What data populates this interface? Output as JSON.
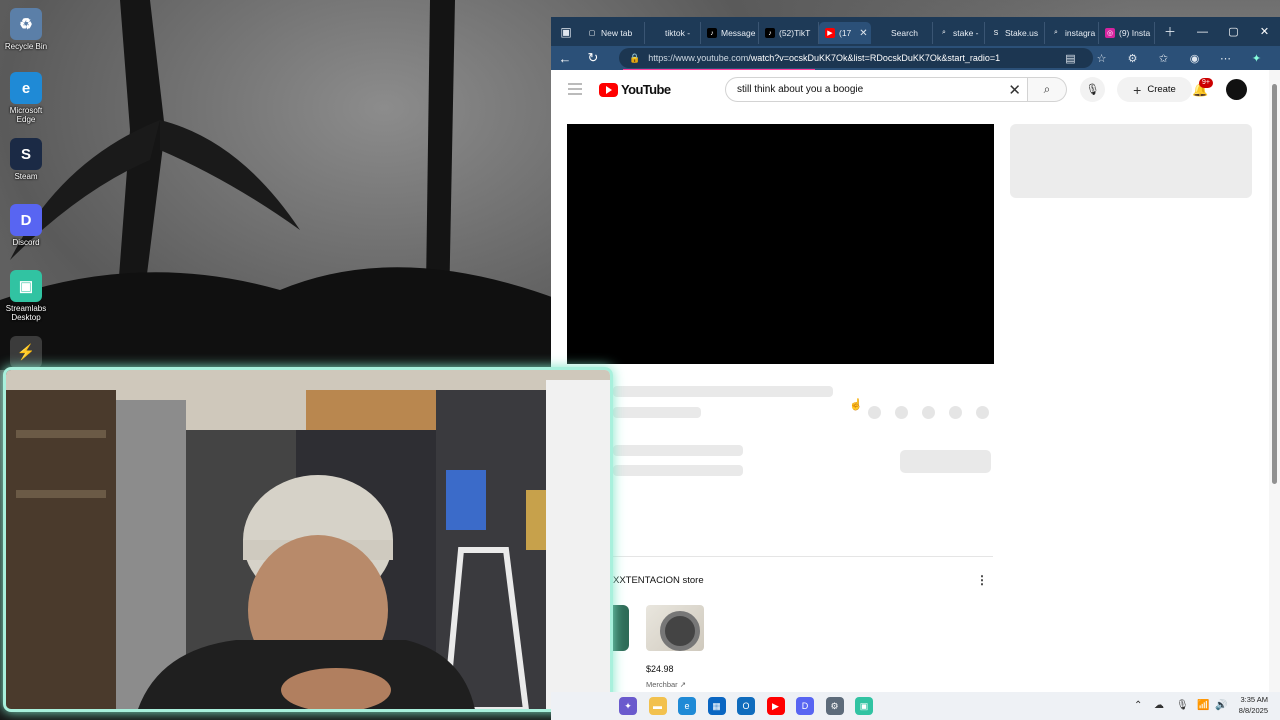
{
  "desktop": {
    "icons": [
      {
        "label": "Recycle Bin",
        "glyph": "♻",
        "color": "#5b7fa8",
        "icon": "recycle-bin-icon"
      },
      {
        "label": "Microsoft Edge",
        "glyph": "e",
        "color": "#1f8ad6",
        "icon": "edge-icon"
      },
      {
        "label": "Steam",
        "glyph": "S",
        "color": "#1b2a45",
        "icon": "steam-icon"
      },
      {
        "label": "Discord",
        "glyph": "D",
        "color": "#5865f2",
        "icon": "discord-icon"
      },
      {
        "label": "Streamlabs Desktop",
        "glyph": "▣",
        "color": "#31c3a2",
        "icon": "streamlabs-icon"
      },
      {
        "label": "",
        "glyph": "⚡",
        "color": "#3b3b3b",
        "icon": "game-launcher-icon"
      }
    ]
  },
  "browser": {
    "tabs": [
      {
        "label": "New tab",
        "favicon": "new-tab-icon",
        "fav_glyph": "▢",
        "fav_color": "#1e3a57"
      },
      {
        "label": "tiktok - ",
        "favicon": "tiktok-icon",
        "fav_glyph": "",
        "fav_color": "#1e3a57"
      },
      {
        "label": "Message",
        "favicon": "tiktok-icon",
        "fav_glyph": "♪",
        "fav_color": "#000000"
      },
      {
        "label": "(52)TikT",
        "favicon": "tiktok-icon",
        "fav_glyph": "♪",
        "fav_color": "#000000"
      },
      {
        "label": "(17",
        "favicon": "youtube-icon",
        "fav_glyph": "▶",
        "fav_color": "#ff0000",
        "active": true
      },
      {
        "label": "Search",
        "favicon": "search-icon",
        "fav_glyph": "",
        "fav_color": "#1e3a57"
      },
      {
        "label": "stake - ",
        "favicon": "search-icon",
        "fav_glyph": "⌕",
        "fav_color": "#1e3a57"
      },
      {
        "label": "Stake.us",
        "favicon": "stake-icon",
        "fav_glyph": "S",
        "fav_color": "#1e3a57"
      },
      {
        "label": "instagra",
        "favicon": "search-icon",
        "fav_glyph": "⌕",
        "fav_color": "#1e3a57"
      },
      {
        "label": "(9) Insta",
        "favicon": "instagram-icon",
        "fav_glyph": "◎",
        "fav_color": "#d6249f"
      }
    ],
    "url_host": "https://www.youtube.com",
    "url_path": "/watch?v=ocskDuKK7Ok&list=RDocskDuKK7Ok&start_radio=1"
  },
  "youtube": {
    "logo_text": "YouTube",
    "search_value": "still think about you a boogie",
    "create_label": "Create",
    "notification_badge": "9+",
    "store_title": "XXTENTACION store",
    "merch_price": "$24.98",
    "merch_vendor": "Merchbar"
  },
  "taskbar": {
    "time": "3:35 AM",
    "date": "8/8/2025",
    "apps": [
      {
        "glyph": "✦",
        "color": "#6a5acd",
        "icon": "copilot-icon"
      },
      {
        "glyph": "▬",
        "color": "#f2c14e",
        "icon": "file-explorer-icon"
      },
      {
        "glyph": "e",
        "color": "#1f8ad6",
        "icon": "edge-icon"
      },
      {
        "glyph": "▦",
        "color": "#0a66c2",
        "icon": "store-icon"
      },
      {
        "glyph": "O",
        "color": "#0f6cbd",
        "icon": "outlook-icon"
      },
      {
        "glyph": "▶",
        "color": "#ff0000",
        "icon": "youtube-icon"
      },
      {
        "glyph": "D",
        "color": "#5865f2",
        "icon": "discord-icon"
      },
      {
        "glyph": "⚙",
        "color": "#5d6b7a",
        "icon": "settings-icon"
      },
      {
        "glyph": "▣",
        "color": "#31c3a2",
        "icon": "streamlabs-icon"
      }
    ]
  }
}
